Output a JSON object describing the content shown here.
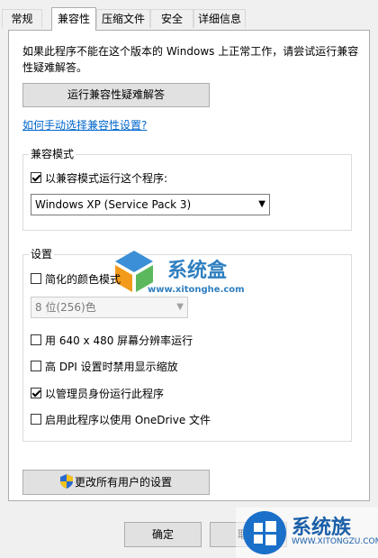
{
  "tabs": [
    {
      "label": "常规"
    },
    {
      "label": "兼容性",
      "active": true
    },
    {
      "label": "压缩文件"
    },
    {
      "label": "安全"
    },
    {
      "label": "详细信息"
    }
  ],
  "intro_text": "如果此程序不能在这个版本的 Windows 上正常工作，请尝试运行兼容性疑难解答。",
  "troubleshoot_button": "运行兼容性疑难解答",
  "manual_link": "如何手动选择兼容性设置?",
  "compat_mode": {
    "title": "兼容模式",
    "checkbox_label": "以兼容模式运行这个程序:",
    "checked": true,
    "selected_os": "Windows XP (Service Pack 3)"
  },
  "settings": {
    "title": "设置",
    "reduced_color": {
      "label": "简化的颜色模式",
      "checked": false
    },
    "color_select": "8 位(256)色",
    "run_640": {
      "label": "用 640 x 480 屏幕分辨率运行",
      "checked": false
    },
    "high_dpi": {
      "label": "高 DPI 设置时禁用显示缩放",
      "checked": false
    },
    "run_admin": {
      "label": "以管理员身份运行此程序",
      "checked": true
    },
    "onedrive": {
      "label": "启用此程序以使用 OneDrive 文件",
      "checked": false
    }
  },
  "change_all_button": "更改所有用户的设置",
  "ok_button": "确定",
  "cancel_button": "取消",
  "watermark": {
    "site_name": "系统盒",
    "site_url": "www.xitonghe.com",
    "site2_name": "系统族",
    "site2_url": "WWW.XITONGZU.COM"
  },
  "colors": {
    "link": "#0066cc",
    "button_bg": "#e1e1e1",
    "panel_bg": "#ffffff",
    "window_bg": "#f0f0f0"
  }
}
